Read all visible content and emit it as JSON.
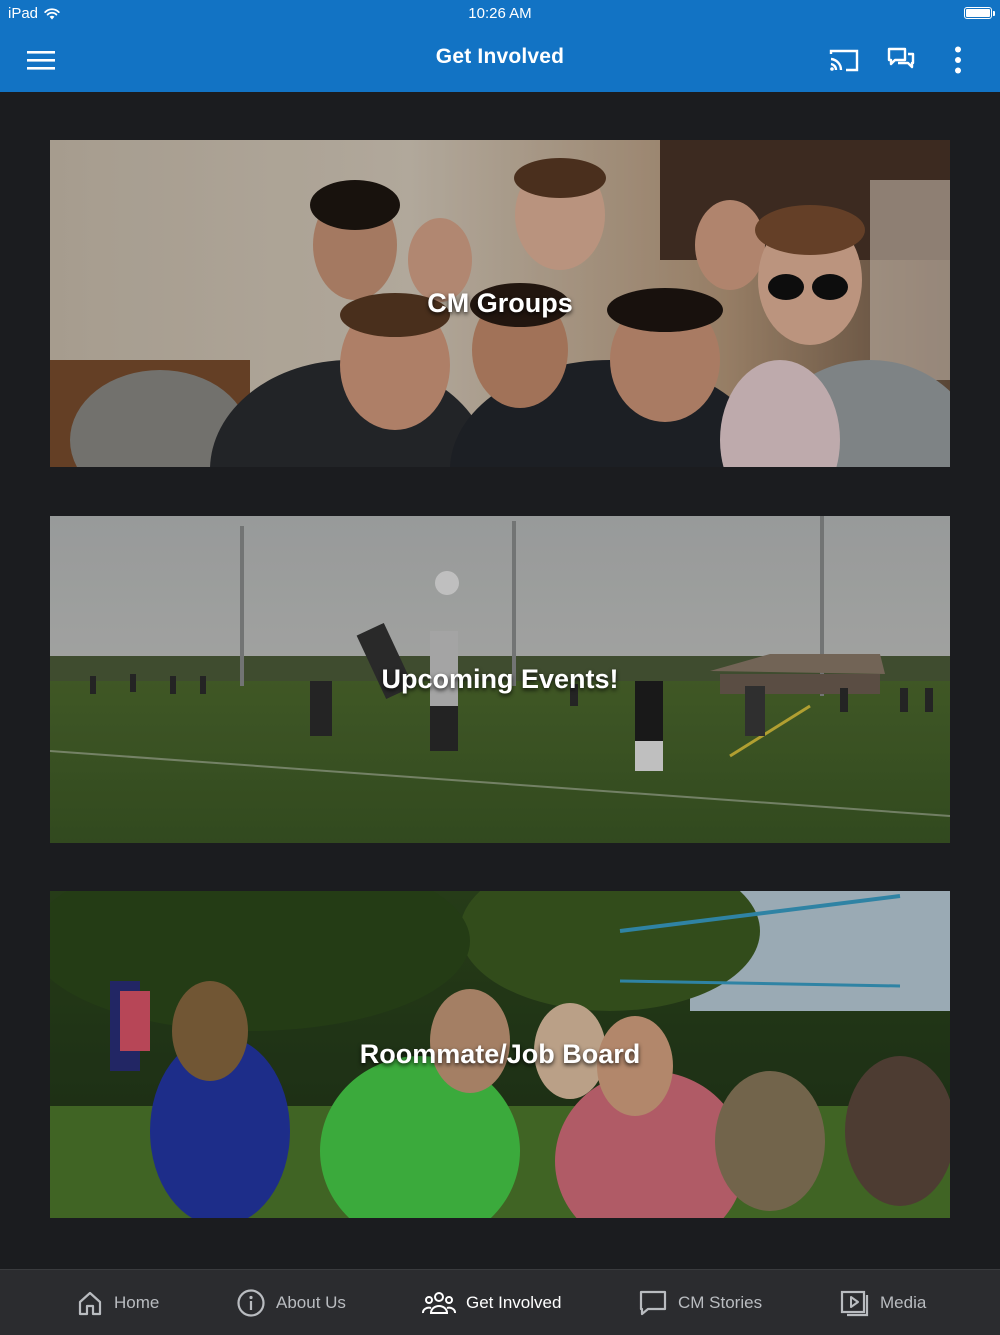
{
  "status_bar": {
    "carrier": "iPad",
    "time": "10:26 AM",
    "wifi_icon": "wifi-icon",
    "battery_icon": "battery-icon"
  },
  "header": {
    "title": "Get Involved",
    "background_color": "#1273c4",
    "icons": [
      "hamburger-menu-icon",
      "cast-icon",
      "chat-bubbles-icon",
      "more-vertical-icon"
    ]
  },
  "cards": [
    {
      "label": "CM Groups",
      "image": "group-of-young-men-smiling-photo"
    },
    {
      "label": "Upcoming Events!",
      "image": "ultimate-frisbee-on-field-photo"
    },
    {
      "label": "Roommate/Job Board",
      "image": "students-sitting-on-grass-photo"
    }
  ],
  "tabs": [
    {
      "label": "Home",
      "icon": "home-icon",
      "active": false
    },
    {
      "label": "About Us",
      "icon": "info-icon",
      "active": false
    },
    {
      "label": "Get Involved",
      "icon": "people-group-icon",
      "active": true
    },
    {
      "label": "CM Stories",
      "icon": "speech-bubble-icon",
      "active": false
    },
    {
      "label": "Media",
      "icon": "media-play-icon",
      "active": false
    }
  ]
}
